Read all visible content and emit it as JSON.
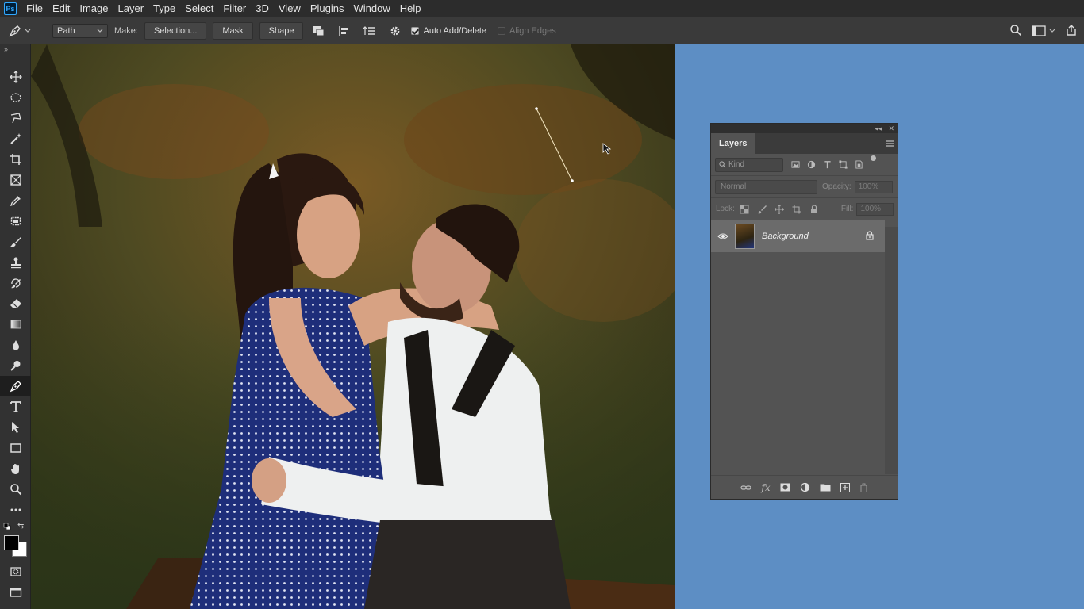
{
  "app": {
    "logo": "Ps"
  },
  "menu": [
    "File",
    "Edit",
    "Image",
    "Layer",
    "Type",
    "Select",
    "Filter",
    "3D",
    "View",
    "Plugins",
    "Window",
    "Help"
  ],
  "options": {
    "mode": "Path",
    "make_label": "Make:",
    "selection_btn": "Selection...",
    "mask_btn": "Mask",
    "shape_btn": "Shape",
    "auto_add_delete": "Auto Add/Delete",
    "auto_add_delete_checked": true,
    "align_edges": "Align Edges",
    "align_edges_checked": false
  },
  "toolbar": {
    "active": "pen-tool",
    "tools": [
      "move-tool",
      "elliptical-marquee-tool",
      "polygonal-lasso-tool",
      "magic-wand-tool",
      "crop-tool",
      "frame-tool",
      "eyedropper-tool",
      "healing-brush-tool",
      "brush-tool",
      "clone-stamp-tool",
      "history-brush-tool",
      "eraser-tool",
      "gradient-tool",
      "blur-tool",
      "dodge-tool",
      "pen-tool",
      "type-tool",
      "path-selection-tool",
      "rectangle-tool",
      "hand-tool",
      "zoom-tool",
      "more-tools"
    ]
  },
  "colors": {
    "foreground": "#000000",
    "background": "#ffffff",
    "workspace": "#5d8ec4"
  },
  "layers_panel": {
    "tab": "Layers",
    "filter_kind": "Kind",
    "blend_mode": "Normal",
    "opacity_label": "Opacity:",
    "opacity_value": "100%",
    "lock_label": "Lock:",
    "fill_label": "Fill:",
    "fill_value": "100%",
    "layers": [
      {
        "name": "Background",
        "visible": true,
        "locked": true
      }
    ]
  }
}
